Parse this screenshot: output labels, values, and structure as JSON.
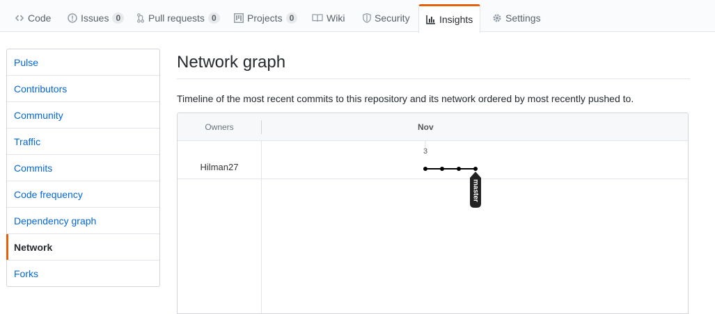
{
  "tabs": [
    {
      "label": "Code",
      "icon": "code-icon"
    },
    {
      "label": "Issues",
      "icon": "issue-icon",
      "count": "0"
    },
    {
      "label": "Pull requests",
      "icon": "pull-request-icon",
      "count": "0"
    },
    {
      "label": "Projects",
      "icon": "project-icon",
      "count": "0"
    },
    {
      "label": "Wiki",
      "icon": "book-icon"
    },
    {
      "label": "Security",
      "icon": "shield-icon"
    },
    {
      "label": "Insights",
      "icon": "graph-icon",
      "selected": true
    },
    {
      "label": "Settings",
      "icon": "gear-icon"
    }
  ],
  "sidebar": {
    "items": [
      {
        "label": "Pulse"
      },
      {
        "label": "Contributors"
      },
      {
        "label": "Community"
      },
      {
        "label": "Traffic"
      },
      {
        "label": "Commits"
      },
      {
        "label": "Code frequency"
      },
      {
        "label": "Dependency graph"
      },
      {
        "label": "Network",
        "selected": true
      },
      {
        "label": "Forks"
      }
    ]
  },
  "main": {
    "title": "Network graph",
    "description": "Timeline of the most recent commits to this repository and its network ordered by most recently pushed to."
  },
  "network": {
    "owners_label": "Owners",
    "month": "Nov",
    "day": "3",
    "owner": "Hilman27",
    "branch": "master",
    "commit_count": 4
  },
  "colors": {
    "accent": "#e36209",
    "link": "#0366d6",
    "branch_line": "#000000"
  }
}
